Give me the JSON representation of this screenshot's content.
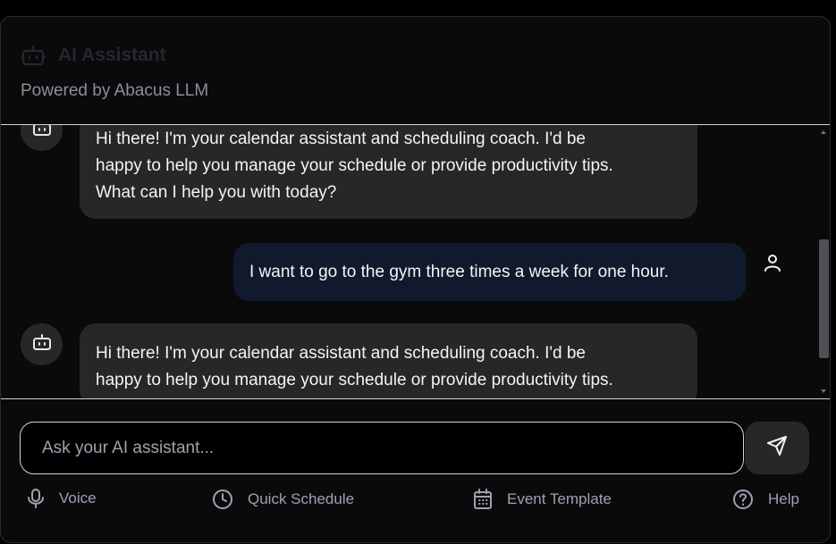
{
  "header": {
    "title": "AI Assistant",
    "subtitle": "Powered by Abacus LLM",
    "icon": "robot-icon"
  },
  "messages": [
    {
      "role": "assistant",
      "lines": [
        "Hi there! I'm your calendar assistant and scheduling coach. I'd be",
        "happy to help you manage your schedule or provide productivity tips.",
        "What can I help you with today?"
      ]
    },
    {
      "role": "user",
      "text": "I want to go to the gym three times a week for one hour."
    },
    {
      "role": "assistant",
      "lines": [
        "Hi there! I'm your calendar assistant and scheduling coach. I'd be",
        "happy to help you manage your schedule or provide productivity tips."
      ]
    }
  ],
  "composer": {
    "placeholder": "Ask your AI assistant...",
    "send_icon": "send-icon"
  },
  "toolbar": {
    "voice": "Voice",
    "quick_schedule": "Quick Schedule",
    "event_template": "Event Template",
    "help": "Help"
  },
  "colors": {
    "background": "#0a0a0b",
    "assistant_bubble": "#27272a",
    "user_bubble": "#111a2c",
    "muted_text": "#9ca3af"
  }
}
